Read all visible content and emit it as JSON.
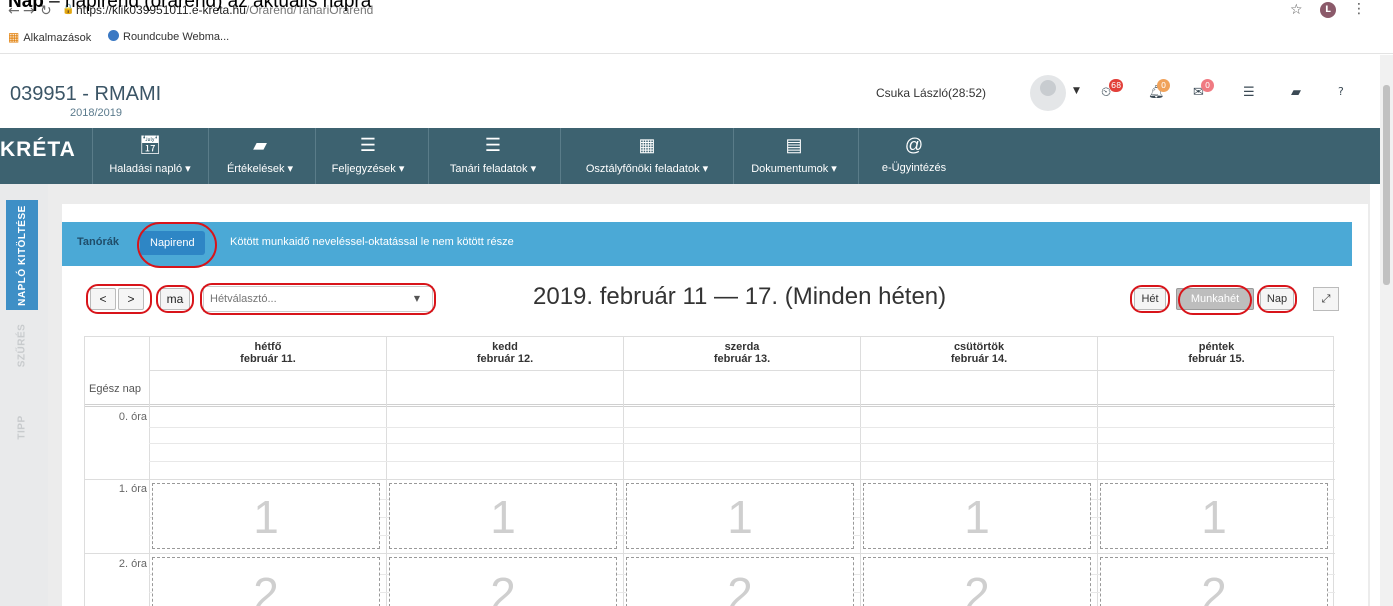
{
  "caption": {
    "bold": "Nap",
    "rest": " – napirend (órarend) az aktuális napra"
  },
  "browser": {
    "url_host": "https://klik039951011.e-kreta.hu",
    "url_path": "/Orarend/TanariOrarend",
    "profile_initial": "L"
  },
  "bookmarks": {
    "apps": "Alkalmazások",
    "roundcube": "Roundcube Webma..."
  },
  "header": {
    "school_id": "039951 - RMAMI",
    "school_year": "2018/2019",
    "user": "Csuka László(28:52)",
    "badge_timer": "68",
    "badge_bell": "0",
    "badge_mail": "0",
    "help": "?"
  },
  "menu": {
    "logo": "KRÉTA",
    "items": [
      {
        "label": "Haladási napló ▾",
        "icon": "calendar-check-icon"
      },
      {
        "label": "Értékelések ▾",
        "icon": "book-icon"
      },
      {
        "label": "Feljegyzések ▾",
        "icon": "list-icon"
      },
      {
        "label": "Tanári feladatok ▾",
        "icon": "list-icon"
      },
      {
        "label": "Osztályfőnöki feladatok ▾",
        "icon": "grid-icon"
      },
      {
        "label": "Dokumentumok ▾",
        "icon": "document-icon"
      },
      {
        "label": "e-Ügyintézés",
        "icon": "at-icon"
      }
    ]
  },
  "rail": {
    "tab1": "NAPLÓ KITÖLTÉSE",
    "tab2": "SZŰRÉS",
    "tab3": "TIPP"
  },
  "tabs": {
    "tanorak": "Tanórák",
    "napirend": "Napirend",
    "kotott": "Kötött munkaidő neveléssel-oktatással le nem kötött része"
  },
  "controls": {
    "prev": "<",
    "next": ">",
    "today": "ma",
    "week_placeholder": "Hétválasztó...",
    "week_title": "2019. február 11 — 17. (Minden héten)",
    "view_week": "Hét",
    "view_workweek": "Munkahét",
    "view_day": "Nap",
    "active_view": "Munkahét"
  },
  "calendar": {
    "days": [
      {
        "name": "hétfő",
        "date": "február 11."
      },
      {
        "name": "kedd",
        "date": "február 12."
      },
      {
        "name": "szerda",
        "date": "február 13."
      },
      {
        "name": "csütörtök",
        "date": "február 14."
      },
      {
        "name": "péntek",
        "date": "február 15."
      }
    ],
    "all_day": "Egész nap",
    "periods": [
      "0. óra",
      "1. óra",
      "2. óra"
    ],
    "lesson_numbers": [
      "1",
      "2"
    ]
  },
  "colors": {
    "menu_bg": "#3d6270",
    "tab_bar": "#4ba9d6",
    "active_rail": "#3e8fc6",
    "annotation": "#d8141a"
  }
}
